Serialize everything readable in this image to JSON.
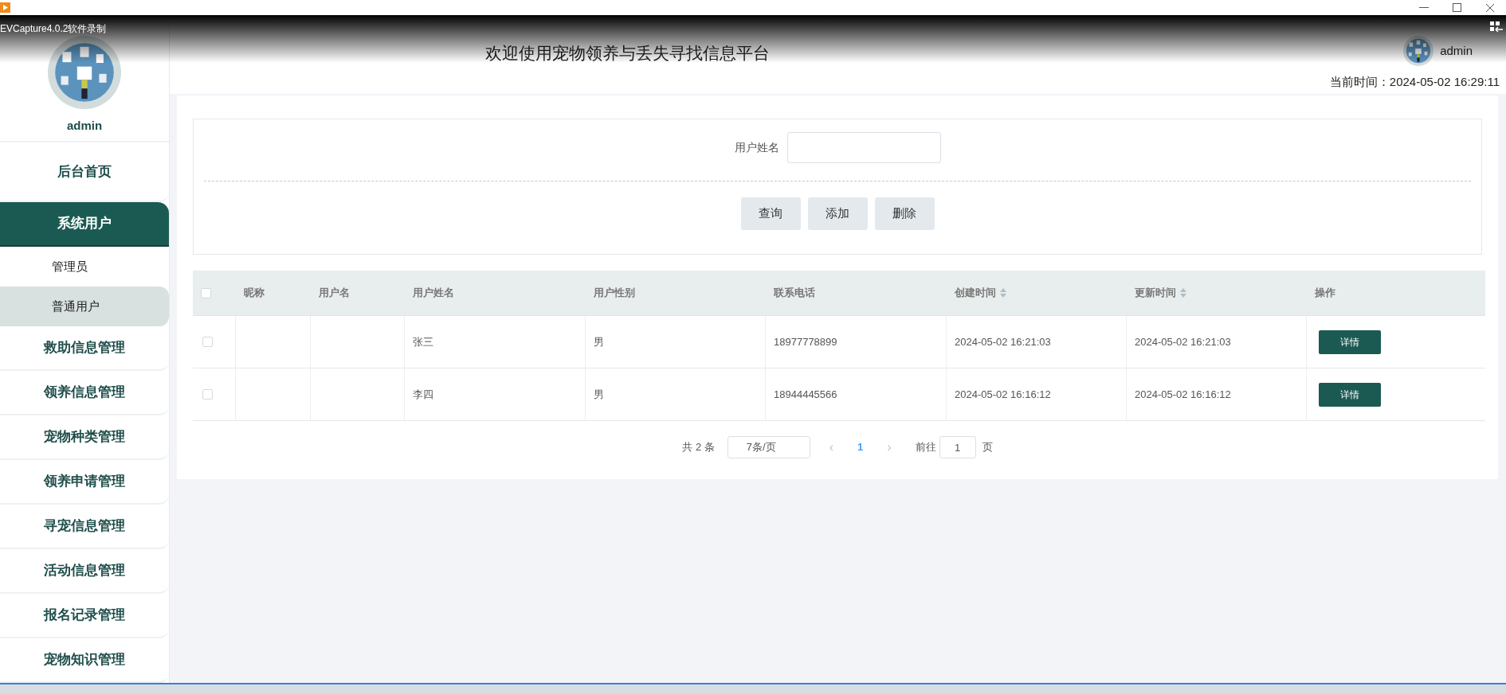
{
  "recorder_label": "EVCapture4.0.2软件录制",
  "sidebar": {
    "user": "admin",
    "items": [
      {
        "label": "后台首页",
        "selected": false
      },
      {
        "label": "系统用户",
        "selected": true,
        "children": [
          {
            "label": "管理员",
            "hovered": false
          },
          {
            "label": "普通用户",
            "hovered": true
          }
        ]
      },
      {
        "label": "救助信息管理",
        "selected": false
      },
      {
        "label": "领养信息管理",
        "selected": false
      },
      {
        "label": "宠物种类管理",
        "selected": false
      },
      {
        "label": "领养申请管理",
        "selected": false
      },
      {
        "label": "寻宠信息管理",
        "selected": false
      },
      {
        "label": "活动信息管理",
        "selected": false
      },
      {
        "label": "报名记录管理",
        "selected": false
      },
      {
        "label": "宠物知识管理",
        "selected": false
      }
    ]
  },
  "header": {
    "title": "欢迎使用宠物领养与丢失寻找信息平台",
    "user": "admin",
    "time_label": "当前时间：",
    "time": "2024-05-02 16:29:11"
  },
  "search": {
    "label": "用户姓名",
    "buttons": [
      "查询",
      "添加",
      "删除"
    ]
  },
  "table": {
    "select_all": {
      "checked": false
    },
    "columns": [
      {
        "label": "昵称",
        "sortable": false
      },
      {
        "label": "用户名",
        "sortable": false
      },
      {
        "label": "用户姓名",
        "sortable": false
      },
      {
        "label": "用户性别",
        "sortable": false
      },
      {
        "label": "联系电话",
        "sortable": false
      },
      {
        "label": "创建时间",
        "sortable": true
      },
      {
        "label": "更新时间",
        "sortable": true
      },
      {
        "label": "操作",
        "sortable": false
      }
    ],
    "rows": [
      {
        "checked": false,
        "cells": [
          "",
          "",
          "张三",
          "男",
          "18977778899",
          "2024-05-02 16:21:03",
          "2024-05-02 16:21:03"
        ],
        "action": "详情"
      },
      {
        "checked": false,
        "cells": [
          "",
          "",
          "李四",
          "男",
          "18944445566",
          "2024-05-02 16:16:12",
          "2024-05-02 16:16:12"
        ],
        "action": "详情"
      }
    ]
  },
  "pagination": {
    "total": "共 2 条",
    "page_size": "7条/页",
    "prev": "‹",
    "pages": [
      {
        "label": "1",
        "selected": true
      }
    ],
    "next": "›",
    "goto_label": "前往",
    "goto_value": "1",
    "goto_suffix": "页"
  }
}
